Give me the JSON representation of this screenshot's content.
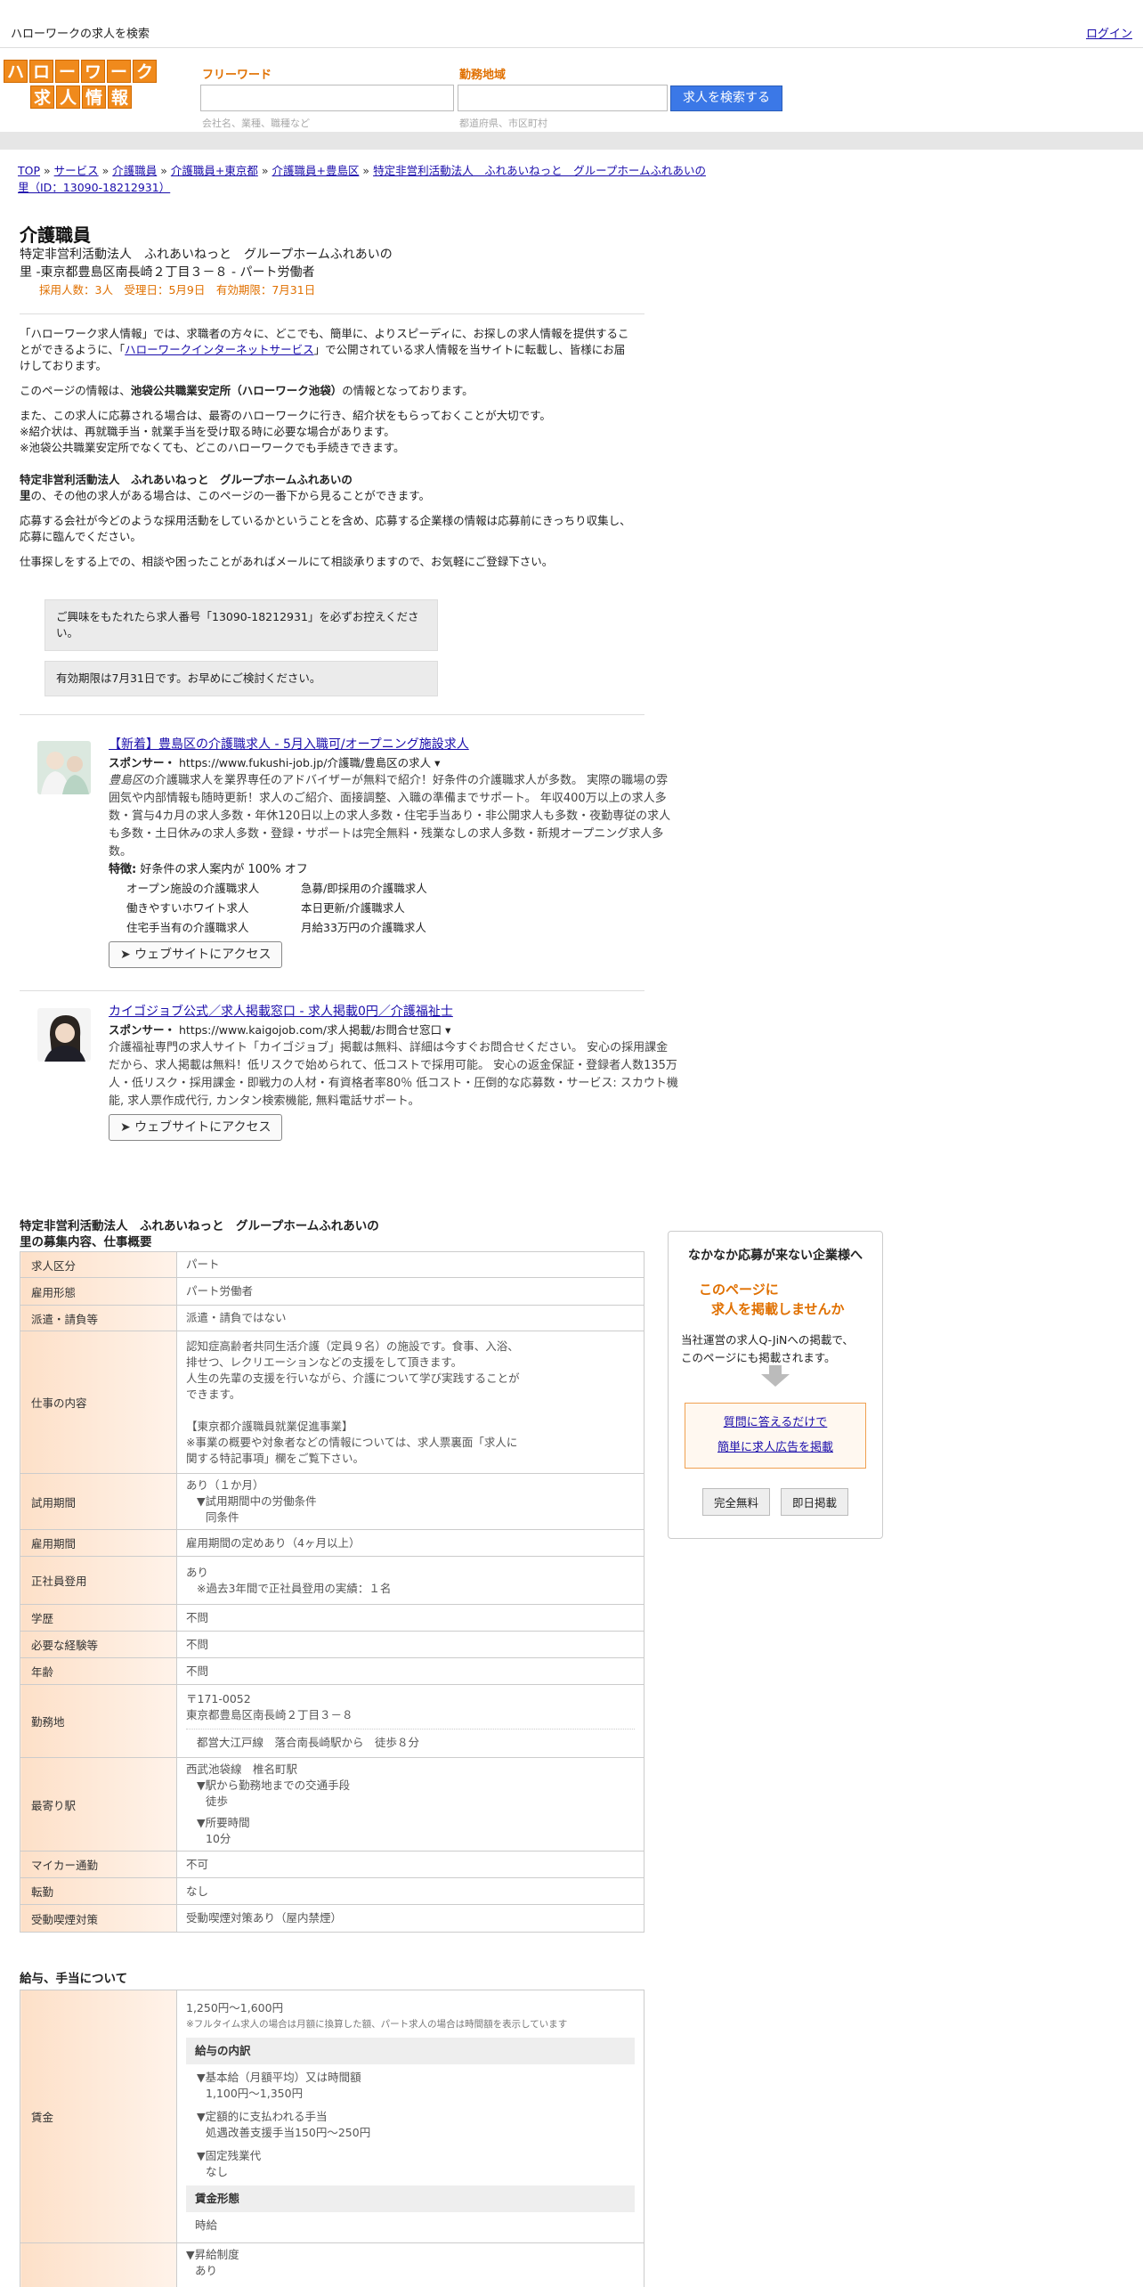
{
  "topbar": {
    "site_title": "ハローワークの求人を検索",
    "login": "ログイン"
  },
  "logo": {
    "row1": [
      "ハ",
      "ロ",
      "ー",
      "ワ",
      "ー",
      "ク"
    ],
    "row2": [
      "求",
      "人",
      "情",
      "報"
    ]
  },
  "search": {
    "keyword_label": "フリーワード",
    "keyword_placeholder": "会社名、業種、職種など",
    "area_label": "勤務地域",
    "area_placeholder": "都道府県、市区町村",
    "button": "求人を検索する"
  },
  "breadcrumb": {
    "items": [
      "TOP",
      "サービス",
      "介護職員",
      "介護職員+東京都",
      "介護職員+豊島区",
      "特定非営利活動法人　ふれあいねっと　グループホームふれあいの"
    ],
    "line2": "里（ID：13090-18212931）"
  },
  "job": {
    "title": "介護職員",
    "company_line1": "特定非営利活動法人　ふれあいねっと　グループホームふれあいの",
    "company_line2": "里 -東京都豊島区南長崎２丁目３－８ - パート労働者",
    "meta": "採用人数：3人　受理日：5月9日　有効期限：7月31日"
  },
  "intro": {
    "p1a": "「ハローワーク求人情報」では、求職者の方々に、どこでも、簡単に、よりスピーディに、お探しの求人情報を提供することができるように、「",
    "p1_link": "ハローワークインターネットサービス",
    "p1b": "」で公開されている求人情報を当サイトに転載し、皆様にお届けしております。",
    "p2a": "このページの情報は、",
    "p2_bold": "池袋公共職業安定所（ハローワーク池袋）",
    "p2b": "の情報となっております。",
    "p3_1": "また、この求人に応募される場合は、最寄のハローワークに行き、紹介状をもらっておくことが大切です。",
    "p3_2": "※紹介状は、再就職手当・就業手当を受け取る時に必要な場合があります。",
    "p3_3": "※池袋公共職業安定所でなくても、どこのハローワークでも手続きできます。",
    "p4_bold1": "特定非営利活動法人　ふれあいねっと　グループホームふれあいの",
    "p4_bold2": "里",
    "p4_rest": "の、その他の求人がある場合は、このページの一番下から見ることができます。",
    "p5": "応募する会社が今どのような採用活動をしているかということを含め、応募する企業様の情報は応募前にきっちり収集し、応募に臨んでください。",
    "p6": "仕事探しをする上での、相談や困ったことがあればメールにて相談承りますので、お気軽にご登録下さい。"
  },
  "notices": {
    "id_notice": "ご興味をもたれたら求人番号「13090-18212931」を必ずお控えください。",
    "expiry_notice": "有効期限は7月31日です。お早めにご検討ください。"
  },
  "ads": [
    {
      "title": "【新着】豊島区の介護職求人 - 5月入職可/オープニング施設求人",
      "sponsor_label": "スポンサー・",
      "sponsor_url": "https://www.fukushi-job.jp/介護職/豊島区の求人 ▾",
      "desc_italic": "豊島区",
      "desc": "の介護職求人を業界専任のアドバイザーが無料で紹介！好条件の介護職求人が多数。 実際の職場の雰囲気や内部情報も随時更新！求人のご紹介、面接調整、入職の準備までサポート。 年収400万以上の求人多数・賞与4カ月の求人多数・年休120日以上の求人多数・住宅手当あり・非公開求人も多数・夜勤専従の求人も多数・土日休みの求人多数・登録・サポートは完全無料・残業なしの求人多数・新規オープニング求人多数。",
      "feature_label": "特徴:",
      "feature": " 好条件の求人案内が 100% オフ",
      "links": [
        "オープン施設の介護職求人",
        "急募/即採用の介護職求人",
        "働きやすいホワイト求人",
        "本日更新/介護職求人",
        "住宅手当有の介護職求人",
        "月給33万円の介護職求人"
      ],
      "button": "➤ ウェブサイトにアクセス"
    },
    {
      "title": "カイゴジョブ公式／求人掲載窓口 - 求人掲載0円／介護福祉士",
      "sponsor_label": "スポンサー・",
      "sponsor_url": "https://www.kaigojob.com/求人掲載/お問合せ窓口 ▾",
      "desc": "介護福祉専門の求人サイト「カイゴジョブ」掲載は無料、詳細は今すぐお問合せください。 安心の採用課金だから、求人掲載は無料！低リスクで始められて、低コストで採用可能。 安心の返金保証・登録者人数135万人・低リスク・採用課金・即戦力の人材・有資格者率80％ 低コスト・圧倒的な応募数・サービス: スカウト機能, 求人票作成代行, カンタン検索機能, 無料電話サポート。",
      "button": "➤ ウェブサイトにアクセス"
    }
  ],
  "section1": {
    "title1": "特定非営利活動法人　ふれあいねっと　グループホームふれあいの",
    "title2": "里の募集内容、仕事概要",
    "rows": {
      "kubun": {
        "k": "求人区分",
        "v": "パート"
      },
      "koyou": {
        "k": "雇用形態",
        "v": "パート労働者"
      },
      "haken": {
        "k": "派遣・請負等",
        "v": "派遣・請負ではない"
      },
      "shigoto": {
        "k": "仕事の内容",
        "v1": "認知症高齢者共同生活介護（定員９名）の施設です。食事、入浴、",
        "v2": "排せつ、レクリエーションなどの支援をして頂きます。",
        "v3": "人生の先輩の支援を行いながら、介護について学び実践することが",
        "v4": "できます。",
        "v5": "【東京都介護職員就業促進事業】",
        "v6": "※事業の概要や対象者などの情報については、求人票裏面「求人に",
        "v7": "関する特記事項」欄をご覧下さい。"
      },
      "shiyou": {
        "k": "試用期間",
        "v1": "あり（１か月）",
        "v2": "▼試用期間中の労働条件",
        "v3": "同条件"
      },
      "koyoukikan": {
        "k": "雇用期間",
        "v": "雇用期間の定めあり（4ヶ月以上）"
      },
      "seishain": {
        "k": "正社員登用",
        "v1": "あり",
        "v2": "※過去3年間で正社員登用の実績：１名"
      },
      "gakureki": {
        "k": "学歴",
        "v": "不問"
      },
      "keiken": {
        "k": "必要な経験等",
        "v": "不問"
      },
      "nenrei": {
        "k": "年齢",
        "v": "不問"
      },
      "kinmuchi": {
        "k": "勤務地",
        "v1": "〒171-0052",
        "v2": "東京都豊島区南長崎２丁目３－８",
        "v3": "都営大江戸線　落合南長崎駅から　徒歩８分"
      },
      "moyori": {
        "k": "最寄り駅",
        "v1": "西武池袋線　椎名町駅",
        "v2": "▼駅から勤務地までの交通手段",
        "v3": "徒歩",
        "v4": "▼所要時間",
        "v5": "10分"
      },
      "mycar": {
        "k": "マイカー通勤",
        "v": "不可"
      },
      "tenkin": {
        "k": "転勤",
        "v": "なし"
      },
      "kitsuen": {
        "k": "受動喫煙対策",
        "v": "受動喫煙対策あり（屋内禁煙）"
      }
    }
  },
  "section2": {
    "title": "給与、手当について",
    "chingin": {
      "k": "賃金",
      "v1": "1,250円〜1,600円",
      "note": "※フルタイム求人の場合は月額に換算した額、パート求人の場合は時間額を表示しています",
      "box1": "給与の内訳",
      "b1": "▼基本給（月額平均）又は時間額",
      "b1v": "1,100円〜1,350円",
      "b2": "▼定額的に支払われる手当",
      "b2v": "処遇改善支援手当150円〜250円",
      "b3": "▼固定残業代",
      "b3v": "なし",
      "box2": "賃金形態",
      "b4": "時給"
    },
    "shokyu": {
      "v1": "▼昇給制度",
      "v2": "あり"
    }
  },
  "side": {
    "heading": "なかなか応募が来ない企業様へ",
    "orange1": "このページに",
    "orange2": "求人を掲載しませんか",
    "text1": "当社運営の求人Q-JiNへの掲載で、",
    "text2": "このページにも掲載されます。",
    "link1": "質問に答えるだけで",
    "link2": "簡単に求人広告を掲載",
    "btn1": "完全無料",
    "btn2": "即日掲載"
  }
}
